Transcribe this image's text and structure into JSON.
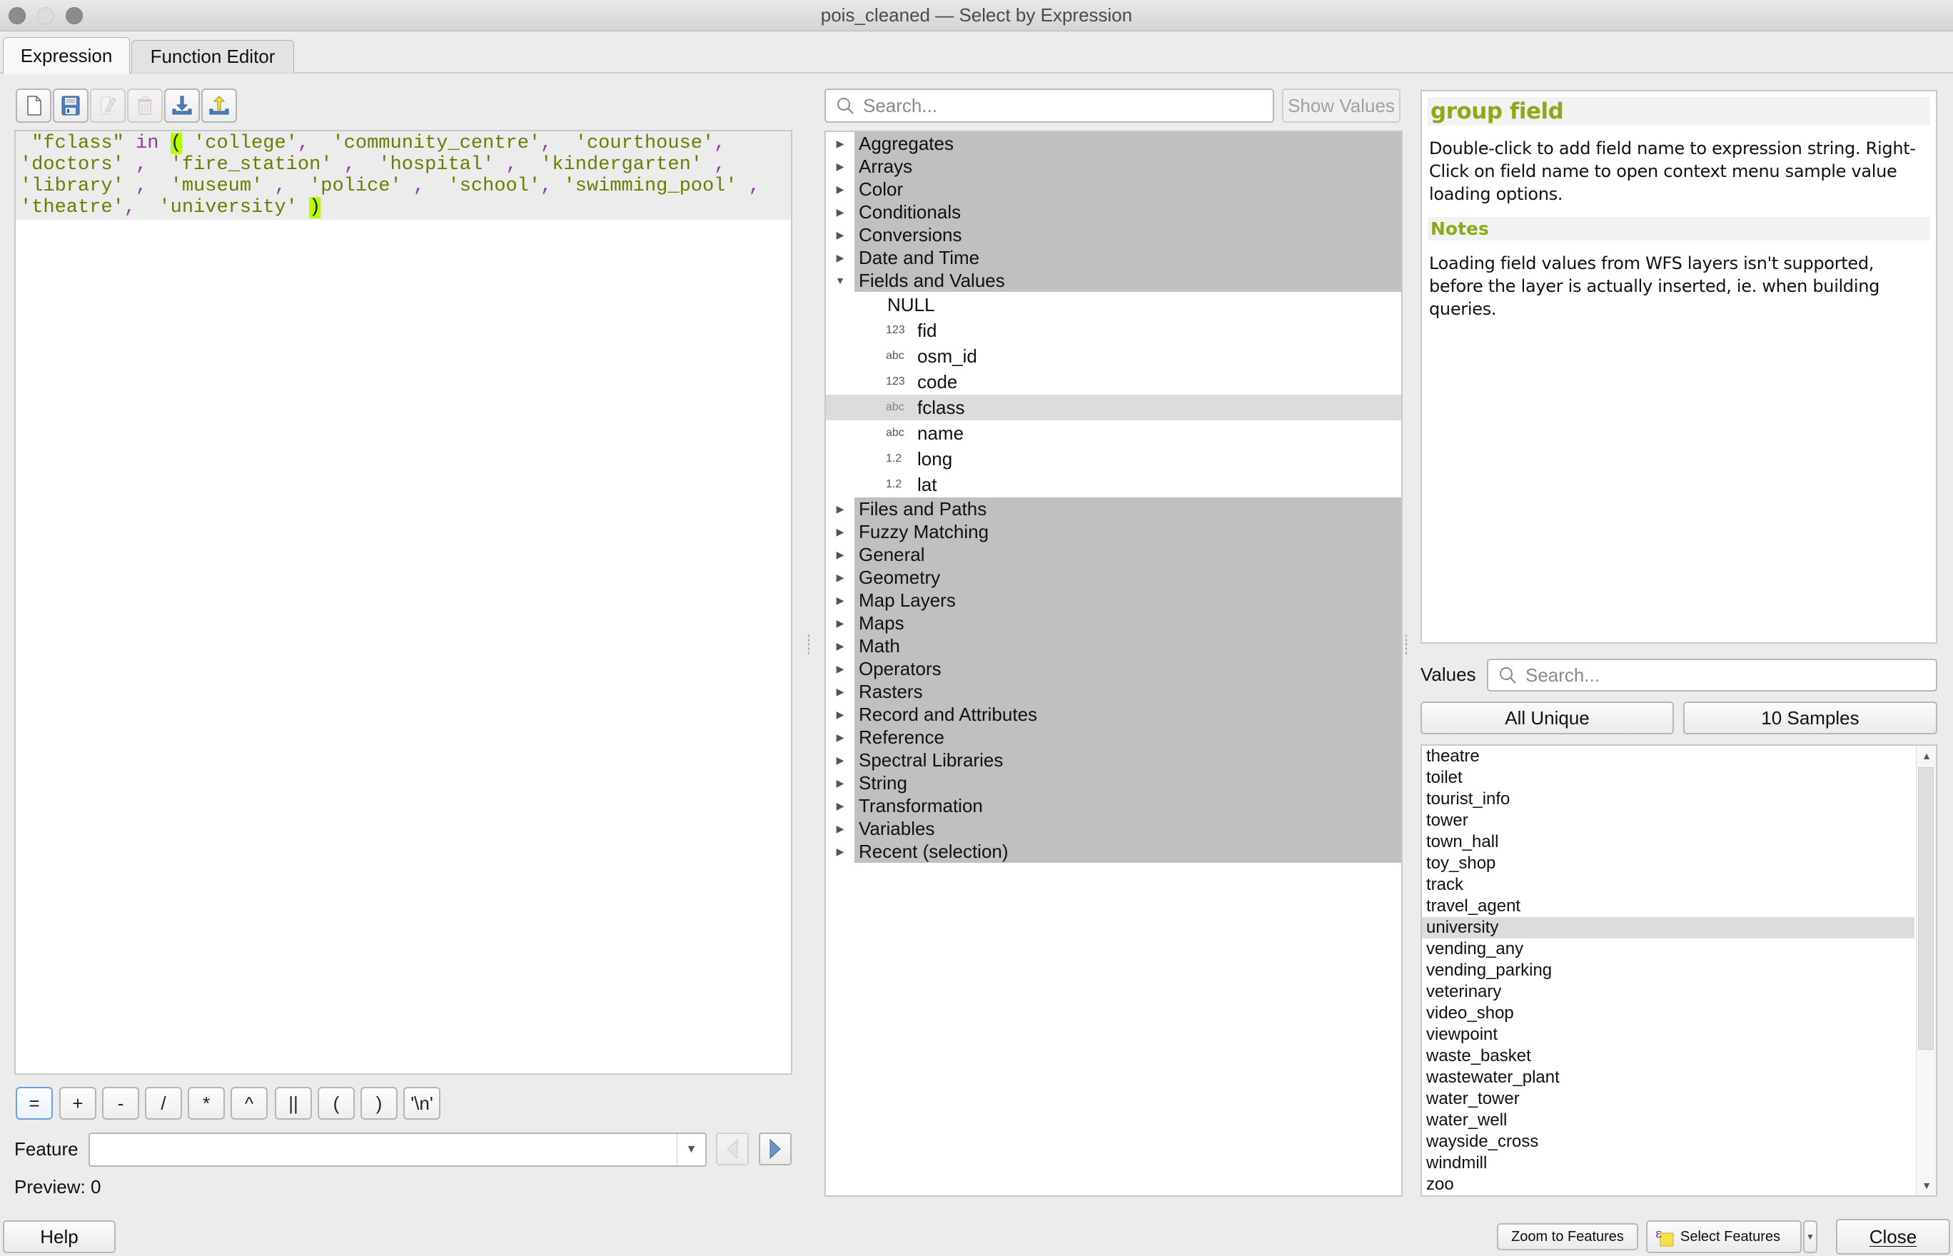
{
  "window": {
    "title": "pois_cleaned — Select by Expression"
  },
  "tabs": [
    {
      "label": "Expression",
      "active": true
    },
    {
      "label": "Function Editor",
      "active": false
    }
  ],
  "toolbar": {
    "icons": [
      "new-file-icon",
      "save-icon",
      "edit-icon",
      "delete-icon",
      "import-icon",
      "export-icon"
    ]
  },
  "expression": {
    "lines": [
      " \"fclass\" in ( 'college',  'community_centre',  'courthouse',",
      "'doctors' ,  'fire_station' ,  'hospital' ,  'kindergarten' ,",
      "'library' ,  'museum' ,  'police' ,  'school', 'swimming_pool' ,",
      "'theatre',  'university' )"
    ],
    "field": "\"fclass\"",
    "keyword": "in",
    "values": [
      "college",
      "community_centre",
      "courthouse",
      "doctors",
      "fire_station",
      "hospital",
      "kindergarten",
      "library",
      "museum",
      "police",
      "school",
      "swimming_pool",
      "theatre",
      "university"
    ]
  },
  "operators": [
    "=",
    "+",
    "-",
    "/",
    "*",
    "^",
    "||",
    "(",
    ")",
    "'\\n'"
  ],
  "feature": {
    "label": "Feature",
    "value": ""
  },
  "preview": {
    "label": "Preview:",
    "value": "0"
  },
  "function_search": {
    "placeholder": "Search...",
    "show_values_label": "Show Values"
  },
  "tree": {
    "groups_before": [
      "Aggregates",
      "Arrays",
      "Color",
      "Conditionals",
      "Conversions",
      "Date and Time"
    ],
    "expanded_group": "Fields and Values",
    "fields": [
      {
        "type": "",
        "name": "NULL"
      },
      {
        "type": "123",
        "name": "fid"
      },
      {
        "type": "abc",
        "name": "osm_id"
      },
      {
        "type": "123",
        "name": "code"
      },
      {
        "type": "abc",
        "name": "fclass",
        "selected": true
      },
      {
        "type": "abc",
        "name": "name"
      },
      {
        "type": "1.2",
        "name": "long"
      },
      {
        "type": "1.2",
        "name": "lat"
      }
    ],
    "groups_after": [
      "Files and Paths",
      "Fuzzy Matching",
      "General",
      "Geometry",
      "Map Layers",
      "Maps",
      "Math",
      "Operators",
      "Rasters",
      "Record and Attributes",
      "Reference",
      "Spectral Libraries",
      "String",
      "Transformation",
      "Variables",
      "Recent (selection)"
    ]
  },
  "help": {
    "title": "group field",
    "body": "Double-click to add field name to expression string. Right-Click on field name to open context menu sample value loading options.",
    "notes_title": "Notes",
    "notes_body": "Loading field values from WFS layers isn't supported, before the layer is actually inserted, ie. when building queries."
  },
  "values_panel": {
    "label": "Values",
    "search_placeholder": "Search...",
    "all_unique_label": "All Unique",
    "samples_label": "10 Samples",
    "items": [
      "theatre",
      "toilet",
      "tourist_info",
      "tower",
      "town_hall",
      "toy_shop",
      "track",
      "travel_agent",
      "university",
      "vending_any",
      "vending_parking",
      "veterinary",
      "video_shop",
      "viewpoint",
      "waste_basket",
      "wastewater_plant",
      "water_tower",
      "water_well",
      "wayside_cross",
      "windmill",
      "zoo"
    ],
    "selected": "university"
  },
  "footer": {
    "help_label": "Help",
    "zoom_label": "Zoom to Features",
    "select_label": "Select Features",
    "close_label": "Close"
  },
  "colors": {
    "string_literal": "#6b7d00",
    "keyword": "#8b3fa0",
    "bracket_highlight": "#b6ff00",
    "help_heading": "#8aaa1a",
    "group_row": "#c0c0c0",
    "selected_row": "#dcdcdc"
  }
}
